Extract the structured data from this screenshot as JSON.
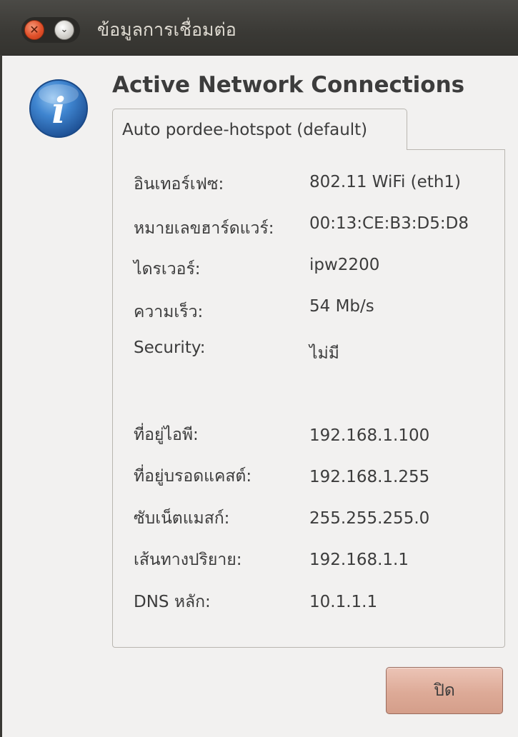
{
  "window": {
    "title": "ข้อมูลการเชื่อมต่อ",
    "close_glyph": "✕",
    "menu_glyph": "⌄"
  },
  "dialog": {
    "heading": "Active Network Connections",
    "tab_label": "Auto pordee-hotspot (default)",
    "rows": [
      {
        "label": "อินเทอร์เฟซ:",
        "value": "802.11 WiFi (eth1)"
      },
      {
        "label": "หมายเลขฮาร์ดแวร์:",
        "value": "00:13:CE:B3:D5:D8"
      },
      {
        "label": "ไดรเวอร์:",
        "value": "ipw2200"
      },
      {
        "label": "ความเร็ว:",
        "value": "54 Mb/s"
      },
      {
        "label": "Security:",
        "value": "ไม่มี"
      },
      {
        "label": "ที่อยู่ไอพี:",
        "value": "192.168.1.100"
      },
      {
        "label": "ที่อยู่บรอดแคสต์:",
        "value": "192.168.1.255"
      },
      {
        "label": "ซับเน็ตแมสก์:",
        "value": "255.255.255.0"
      },
      {
        "label": "เส้นทางปริยาย:",
        "value": "192.168.1.1"
      },
      {
        "label": "DNS หลัก:",
        "value": "10.1.1.1"
      }
    ],
    "close_button_label": "ปิด"
  },
  "icons": {
    "info": "info-icon",
    "info_glyph": "i"
  },
  "colors": {
    "titlebar": "#3c3b37",
    "title_text": "#dfdbd2",
    "close_button": "#ddaa97",
    "info_icon": "#2f6db5"
  }
}
